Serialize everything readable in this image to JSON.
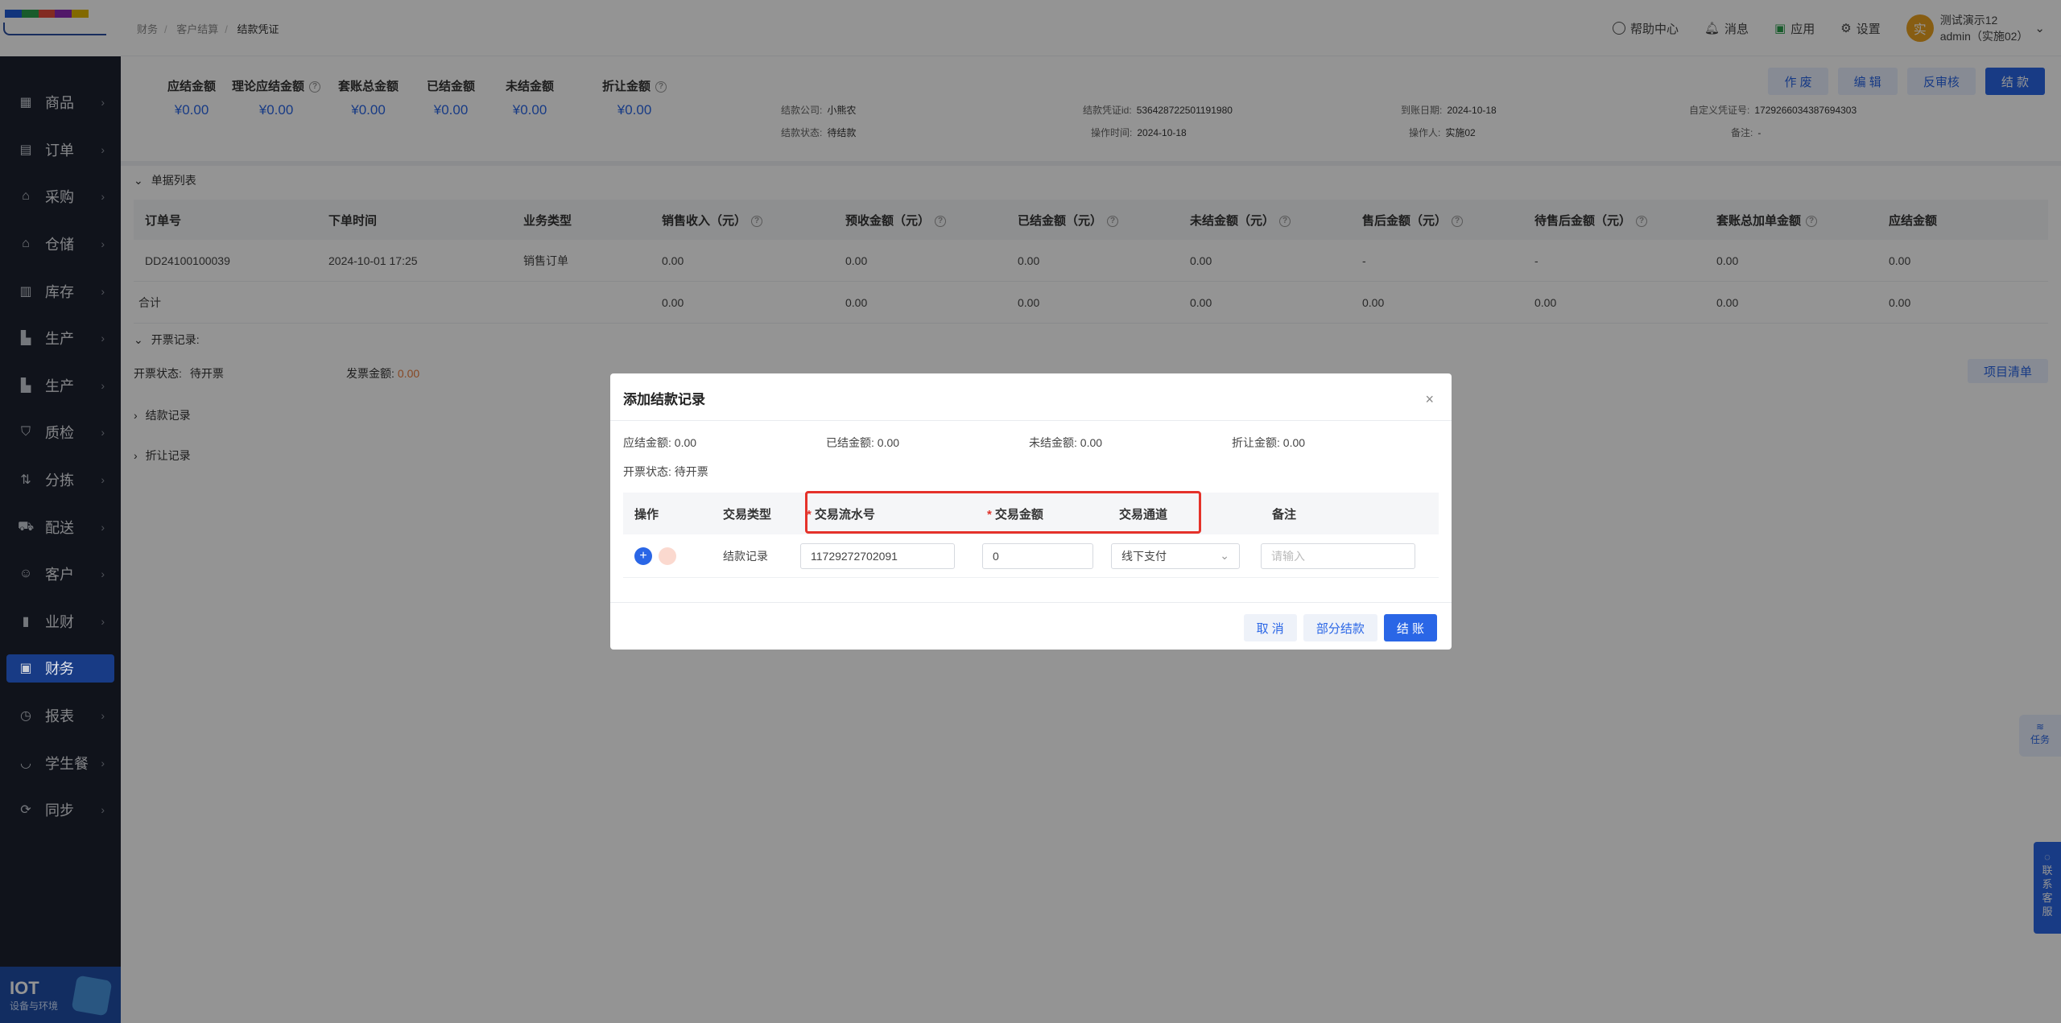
{
  "brand": {
    "colors": [
      "#1e5bd6",
      "#2a9d4b",
      "#e24a3b",
      "#8c2ab5",
      "#e0b500"
    ],
    "bottom_title": "IOT",
    "bottom_sub": "设备与环境"
  },
  "sidebar": {
    "items": [
      {
        "label": "商品",
        "icon": "grid-icon"
      },
      {
        "label": "订单",
        "icon": "clipboard-icon"
      },
      {
        "label": "采购",
        "icon": "basket-icon"
      },
      {
        "label": "仓储",
        "icon": "home-icon"
      },
      {
        "label": "库存",
        "icon": "warehouse-icon"
      },
      {
        "label": "生产",
        "icon": "factory-icon"
      },
      {
        "label": "生产",
        "icon": "factory-icon"
      },
      {
        "label": "质检",
        "icon": "shield-icon"
      },
      {
        "label": "分拣",
        "icon": "sort-icon"
      },
      {
        "label": "配送",
        "icon": "truck-icon"
      },
      {
        "label": "客户",
        "icon": "user-icon"
      },
      {
        "label": "业财",
        "icon": "chart-icon"
      },
      {
        "label": "财务",
        "icon": "wallet-icon"
      },
      {
        "label": "报表",
        "icon": "clock-icon"
      },
      {
        "label": "学生餐",
        "icon": "bowl-icon"
      },
      {
        "label": "同步",
        "icon": "sync-icon"
      }
    ],
    "active_index": 12
  },
  "header": {
    "breadcrumb": [
      "财务",
      "客户结算",
      "结款凭证"
    ],
    "help": "帮助中心",
    "messages": "消息",
    "apps": "应用",
    "settings": "设置",
    "user_name": "测试演示12",
    "user_org": "admin（实施02）",
    "avatar_char": "实"
  },
  "summary": {
    "kpis": [
      {
        "label": "应结金额",
        "value": "¥0.00",
        "help": false
      },
      {
        "label": "理论应结金额",
        "value": "¥0.00",
        "help": true
      },
      {
        "label": "套账总金额",
        "value": "¥0.00",
        "help": false
      },
      {
        "label": "已结金额",
        "value": "¥0.00",
        "help": false
      },
      {
        "label": "未结金额",
        "value": "¥0.00",
        "help": false
      },
      {
        "label": "折让金额",
        "value": "¥0.00",
        "help": true
      }
    ],
    "info": {
      "company_label": "结款公司:",
      "company": "小熊农",
      "status_label": "结款状态:",
      "status": "待结款",
      "voucher_id_label": "结款凭证id:",
      "voucher_id": "536428722501191980",
      "op_time_label": "操作时间:",
      "op_time": "2024-10-18",
      "due_label": "到账日期:",
      "due": "2024-10-18",
      "operator_label": "操作人:",
      "operator": "实施02",
      "custom_label": "自定义凭证号:",
      "custom": "1729266034387694303",
      "remark_label": "备注:",
      "remark": "-"
    },
    "buttons": {
      "void": "作 废",
      "edit": "编 辑",
      "reverse": "反审核",
      "settle": "结 款"
    }
  },
  "doc_list": {
    "title": "单据列表",
    "headers": [
      "订单号",
      "下单时间",
      "业务类型",
      "销售收入（元）",
      "预收金额（元）",
      "已结金额（元）",
      "未结金额（元）",
      "售后金额（元）",
      "待售后金额（元）",
      "套账总加单金额",
      "应结金额"
    ],
    "rows": [
      [
        "DD24100100039",
        "2024-10-01 17:25",
        "销售订单",
        "0.00",
        "0.00",
        "0.00",
        "0.00",
        "-",
        "-",
        "0.00",
        "0.00"
      ]
    ],
    "total": [
      "合计",
      "",
      "",
      "0.00",
      "0.00",
      "0.00",
      "0.00",
      "0.00",
      "0.00",
      "0.00",
      "0.00"
    ]
  },
  "invoice": {
    "title": "开票记录:",
    "status_label": "开票状态:",
    "status": "待开票",
    "amount_label": "发票金额:",
    "amount": "0.00",
    "items_button": "项目清单"
  },
  "collapsed": {
    "settle_records": "结款记录",
    "discount_records": "折让记录"
  },
  "modal": {
    "title": "添加结款记录",
    "summary": [
      {
        "label": "应结金额:",
        "value": "0.00"
      },
      {
        "label": "已结金额:",
        "value": "0.00"
      },
      {
        "label": "未结金额:",
        "value": "0.00"
      },
      {
        "label": "折让金额:",
        "value": "0.00"
      }
    ],
    "invoice_label": "开票状态:",
    "invoice_value": "待开票",
    "headers": {
      "op": "操作",
      "type": "交易类型",
      "serial": "交易流水号",
      "amount": "交易金额",
      "channel": "交易通道",
      "remark": "备注"
    },
    "row": {
      "type": "结款记录",
      "serial": "11729272702091",
      "amount": "0",
      "channel": "线下支付",
      "remark_placeholder": "请输入"
    },
    "buttons": {
      "cancel": "取 消",
      "partial": "部分结款",
      "settle": "结 账"
    }
  },
  "floating": {
    "task": "任务",
    "service": [
      "联",
      "系",
      "客",
      "服"
    ]
  }
}
